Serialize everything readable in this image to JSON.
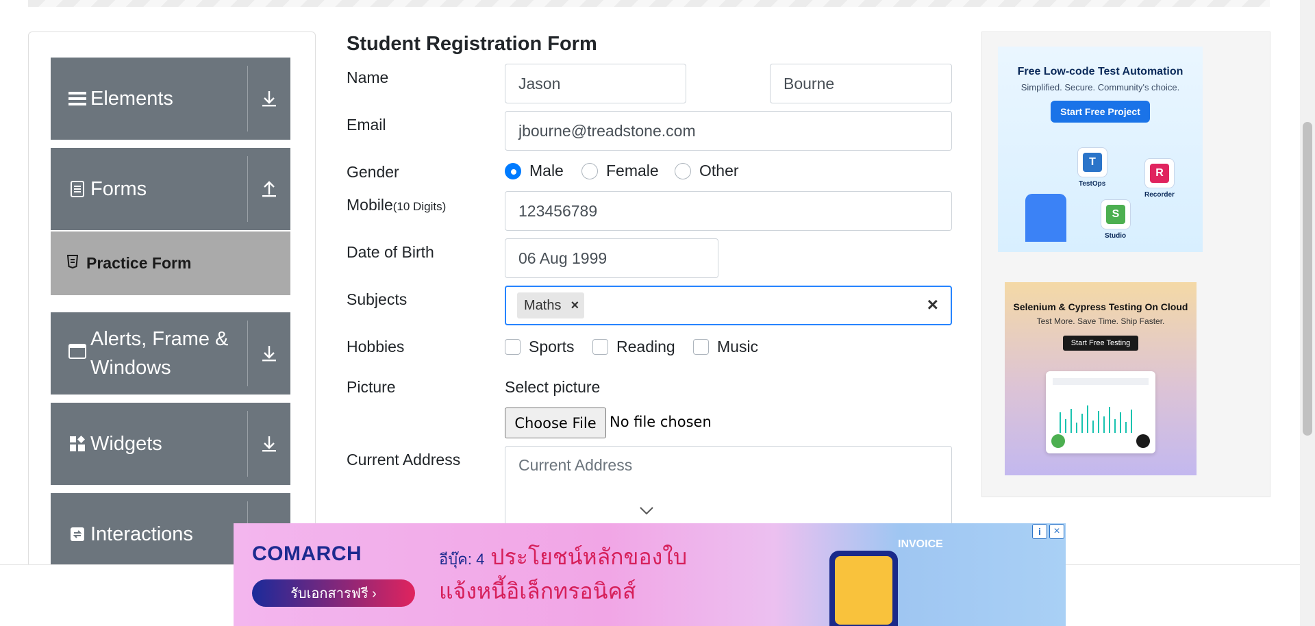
{
  "sidebar": {
    "groups": [
      {
        "label": "Elements",
        "icon": "hamburger-icon",
        "toggle_icon": "download-arrow-icon"
      },
      {
        "label": "Forms",
        "icon": "document-icon",
        "toggle_icon": "upload-arrow-icon"
      },
      {
        "label": "Alerts, Frame & Windows",
        "label_line1": "Alerts, Frame &",
        "label_line2": "Windows",
        "icon": "window-icon",
        "toggle_icon": "download-arrow-icon"
      },
      {
        "label": "Widgets",
        "icon": "widgets-icon",
        "toggle_icon": "download-arrow-icon"
      },
      {
        "label": "Interactions",
        "icon": "interactions-icon",
        "toggle_icon": "download-arrow-icon"
      }
    ],
    "active_item": {
      "label": "Practice Form",
      "icon": "html5-icon"
    }
  },
  "form": {
    "title": "Student Registration Form",
    "name": {
      "label": "Name",
      "first": "Jason",
      "last": "Bourne"
    },
    "email": {
      "label": "Email",
      "value": "jbourne@treadstone.com"
    },
    "gender": {
      "label": "Gender",
      "options": [
        "Male",
        "Female",
        "Other"
      ],
      "selected": "Male"
    },
    "mobile": {
      "label": "Mobile",
      "hint": "(10 Digits)",
      "value": "123456789"
    },
    "dob": {
      "label": "Date of Birth",
      "value": "06 Aug 1999"
    },
    "subjects": {
      "label": "Subjects",
      "chips": [
        "Maths"
      ]
    },
    "hobbies": {
      "label": "Hobbies",
      "options": [
        "Sports",
        "Reading",
        "Music"
      ]
    },
    "picture": {
      "label": "Picture",
      "select_label": "Select picture",
      "button": "Choose File",
      "status": "No file chosen"
    },
    "address": {
      "label": "Current Address",
      "placeholder": "Current Address"
    }
  },
  "ads": {
    "ad1": {
      "title": "Free Low-code Test Automation",
      "subtitle": "Simplified. Secure. Community's choice.",
      "button": "Start Free Project",
      "nodes": [
        "TestOps",
        "Recorder",
        "Studio"
      ]
    },
    "ad2": {
      "title": "Selenium & Cypress Testing On Cloud",
      "subtitle": "Test More. Save Time. Ship Faster.",
      "button": "Start Free Testing"
    },
    "bottom": {
      "brand": "COMARCH",
      "button": "รับเอกสารฟรี ›",
      "line1_prefix": "อีบุ๊ค: 4",
      "line1": "ประโยชน์หลักของใบ",
      "line2": "แจ้งหนี้อิเล็กทรอนิคส์",
      "tag": "INVOICE"
    }
  },
  "colors": {
    "sidebar_bg": "#6c757d",
    "active_item_bg": "#aaaaaa",
    "accent": "#007bff",
    "focus_border": "#2684ff"
  }
}
